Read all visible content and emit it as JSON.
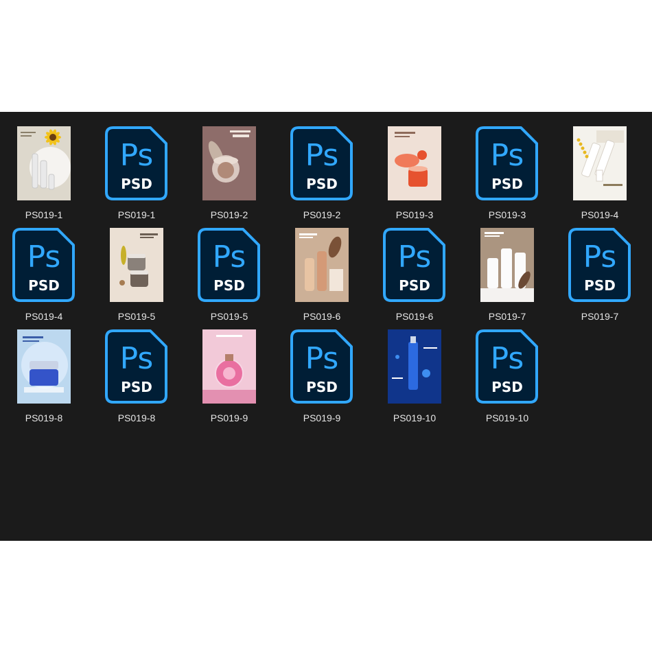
{
  "files": [
    {
      "label": "PS019-1",
      "kind": "image",
      "bg": "#ddd8cc",
      "accent": "#f2c21a",
      "product": "#e9e9ea",
      "scene": "sunflower"
    },
    {
      "label": "PS019-1",
      "kind": "psd",
      "icon": "psd-file-icon"
    },
    {
      "label": "PS019-2",
      "kind": "image",
      "bg": "#8e6d6a",
      "accent": "#c6b3a5",
      "product": "#d9c8c0",
      "scene": "jar"
    },
    {
      "label": "PS019-2",
      "kind": "psd",
      "icon": "psd-file-icon"
    },
    {
      "label": "PS019-3",
      "kind": "image",
      "bg": "#efe0d6",
      "accent": "#e6522f",
      "product": "#f07a5a",
      "scene": "orange"
    },
    {
      "label": "PS019-3",
      "kind": "psd",
      "icon": "psd-file-icon"
    },
    {
      "label": "PS019-4",
      "kind": "image",
      "bg": "#f4f2ec",
      "accent": "#e7b820",
      "product": "#ffffff",
      "scene": "tubes"
    },
    {
      "label": "PS019-4",
      "kind": "psd",
      "icon": "psd-file-icon"
    },
    {
      "label": "PS019-5",
      "kind": "image",
      "bg": "#ebe0d4",
      "accent": "#6f6258",
      "product": "#8a817a",
      "scene": "jars"
    },
    {
      "label": "PS019-5",
      "kind": "psd",
      "icon": "psd-file-icon"
    },
    {
      "label": "PS019-6",
      "kind": "image",
      "bg": "#ccb097",
      "accent": "#7a5137",
      "product": "#e8c4a3",
      "scene": "bottles"
    },
    {
      "label": "PS019-6",
      "kind": "psd",
      "icon": "psd-file-icon"
    },
    {
      "label": "PS019-7",
      "kind": "image",
      "bg": "#ab9580",
      "accent": "#6b4a35",
      "product": "#fbfbfb",
      "scene": "white"
    },
    {
      "label": "PS019-7",
      "kind": "psd",
      "icon": "psd-file-icon"
    },
    {
      "label": "PS019-8",
      "kind": "image",
      "bg": "#bcd8ef",
      "accent": "#3a4fb5",
      "product": "#3454c9",
      "scene": "cream"
    },
    {
      "label": "PS019-8",
      "kind": "psd",
      "icon": "psd-file-icon"
    },
    {
      "label": "PS019-9",
      "kind": "image",
      "bg": "#f2c9d8",
      "accent": "#d94d86",
      "product": "#e96fa0",
      "scene": "perfume"
    },
    {
      "label": "PS019-9",
      "kind": "psd",
      "icon": "psd-file-icon"
    },
    {
      "label": "PS019-10",
      "kind": "image",
      "bg": "#0e2f7a",
      "accent": "#3e8ef0",
      "product": "#2c6ae0",
      "scene": "blue"
    },
    {
      "label": "PS019-10",
      "kind": "psd",
      "icon": "psd-file-icon"
    }
  ],
  "psd_icon": {
    "ps_text": "Ps",
    "psd_text": "PSD",
    "stroke": "#31a8ff",
    "fill": "#001e36",
    "text_color": "#31a8ff"
  }
}
